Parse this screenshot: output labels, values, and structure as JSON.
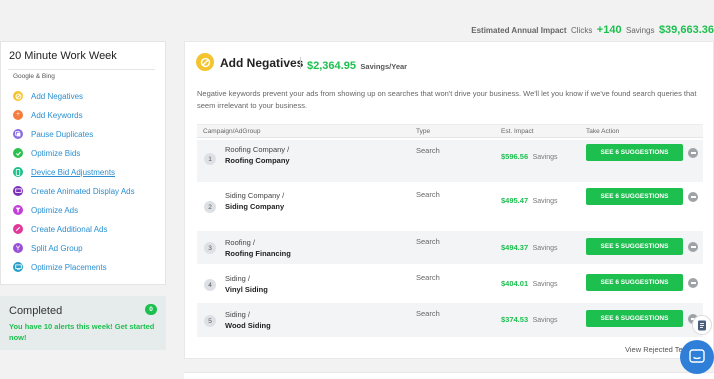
{
  "topbar": {
    "label": "Estimated Annual Impact",
    "clicks_label": "Clicks",
    "clicks_value": "+140",
    "savings_label": "Savings",
    "savings_value": "$39,663.36"
  },
  "sidebar": {
    "title": "20 Minute Work Week",
    "subtitle": "Google & Bing",
    "items": [
      {
        "label": "Add Negatives",
        "icon": "block-icon",
        "color": "#f4c430"
      },
      {
        "label": "Add Keywords",
        "icon": "plus-icon",
        "color": "#f47c3c"
      },
      {
        "label": "Pause Duplicates",
        "icon": "copy-icon",
        "color": "#8a6ce0"
      },
      {
        "label": "Optimize Bids",
        "icon": "check-icon",
        "color": "#2ec04f"
      },
      {
        "label": "Device Bid Adjustments",
        "icon": "mobile-icon",
        "color": "#1dbf8a"
      },
      {
        "label": "Create Animated Display Ads",
        "icon": "display-icon",
        "color": "#7a2fb8"
      },
      {
        "label": "Optimize Ads",
        "icon": "funnel-icon",
        "color": "#c33fd9"
      },
      {
        "label": "Create Additional Ads",
        "icon": "pencil-icon",
        "color": "#e0399a"
      },
      {
        "label": "Split Ad Group",
        "icon": "split-icon",
        "color": "#9a4fd6"
      },
      {
        "label": "Optimize Placements",
        "icon": "screen-icon",
        "color": "#2a9fc6"
      }
    ]
  },
  "completed": {
    "title": "Completed",
    "count": "0",
    "message": "You have 10 alerts this week! Get started now!"
  },
  "panel": {
    "title": "Add Negatives",
    "savings_amount": "$2,364.95",
    "savings_unit": "Savings/Year",
    "description": "Negative keywords prevent your ads from showing up on searches that won't drive your business. We'll let you know if we've found search queries that seem irrelevant to your business.",
    "columns": [
      "Campaign/AdGroup",
      "Type",
      "Est. Impact",
      "Take Action"
    ],
    "rows": [
      {
        "num": "1",
        "campaign": "Roofing Company /",
        "adgroup": "Roofing Company",
        "type": "Search",
        "impact": "$596.56",
        "impact_label": "Savings",
        "action": "SEE 6 SUGGESTIONS"
      },
      {
        "num": "2",
        "campaign": "Siding Company /",
        "adgroup": "Siding Company",
        "type": "Search",
        "impact": "$495.47",
        "impact_label": "Savings",
        "action": "SEE 6 SUGGESTIONS"
      },
      {
        "num": "3",
        "campaign": "Roofing /",
        "adgroup": "Roofing Financing",
        "type": "Search",
        "impact": "$494.37",
        "impact_label": "Savings",
        "action": "SEE 5 SUGGESTIONS"
      },
      {
        "num": "4",
        "campaign": "Siding /",
        "adgroup": "Vinyl Siding",
        "type": "Search",
        "impact": "$404.01",
        "impact_label": "Savings",
        "action": "SEE 6 SUGGESTIONS"
      },
      {
        "num": "5",
        "campaign": "Siding /",
        "adgroup": "Wood Siding",
        "type": "Search",
        "impact": "$374.53",
        "impact_label": "Savings",
        "action": "SEE 6 SUGGESTIONS"
      }
    ],
    "view_rejected": "View Rejected Te"
  }
}
